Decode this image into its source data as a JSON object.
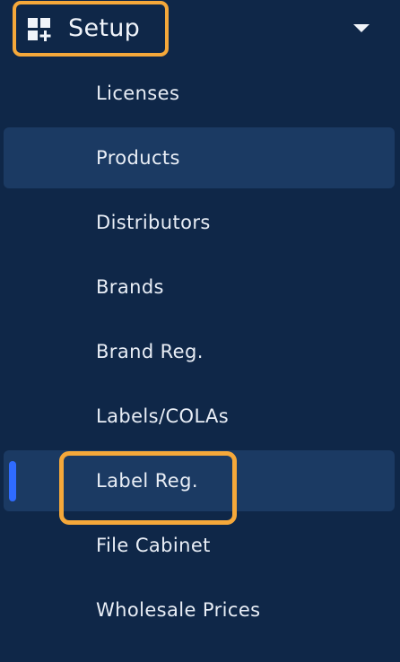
{
  "sidebar": {
    "section": {
      "icon": "dashboard-add-icon",
      "label": "Setup",
      "caret_icon": "caret-down-icon",
      "expanded": true
    },
    "items": [
      {
        "label": "Licenses",
        "highlighted": false,
        "active": false
      },
      {
        "label": "Products",
        "highlighted": true,
        "active": false
      },
      {
        "label": "Distributors",
        "highlighted": false,
        "active": false
      },
      {
        "label": "Brands",
        "highlighted": false,
        "active": false
      },
      {
        "label": "Brand Reg.",
        "highlighted": false,
        "active": false
      },
      {
        "label": "Labels/COLAs",
        "highlighted": false,
        "active": false
      },
      {
        "label": "Label Reg.",
        "highlighted": true,
        "active": true
      },
      {
        "label": "File Cabinet",
        "highlighted": false,
        "active": false
      },
      {
        "label": "Wholesale Prices",
        "highlighted": false,
        "active": false
      }
    ]
  },
  "colors": {
    "background": "#0f2748",
    "item_highlight": "#1b3a63",
    "text": "#e9eef6",
    "callout_outline": "#f5a83a",
    "active_indicator": "#2f6bff"
  }
}
